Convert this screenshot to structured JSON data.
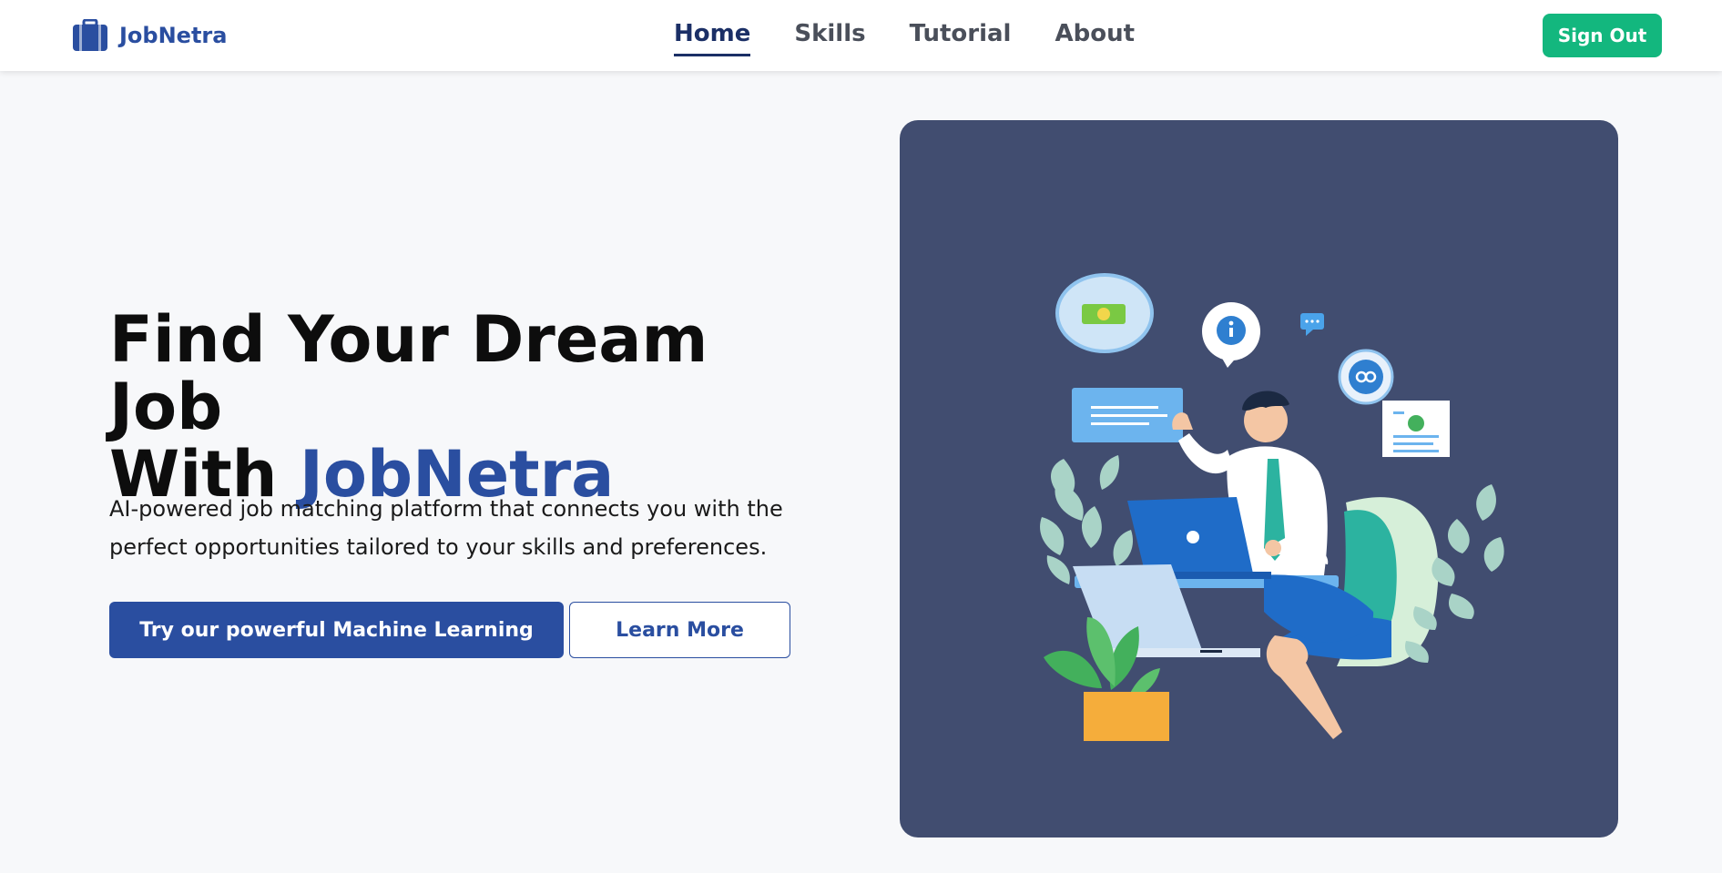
{
  "brand": {
    "name": "JobNetra",
    "icon": "briefcase-icon"
  },
  "nav": {
    "items": [
      {
        "label": "Home",
        "active": true
      },
      {
        "label": "Skills",
        "active": false
      },
      {
        "label": "Tutorial",
        "active": false
      },
      {
        "label": "About",
        "active": false
      }
    ]
  },
  "header": {
    "signout_label": "Sign Out"
  },
  "hero": {
    "title_line1": "Find Your Dream Job",
    "title_line2_prefix": "With ",
    "title_line2_accent": "JobNetra",
    "description": "AI-powered job matching platform that connects you with the perfect opportunities tailored to your skills and preferences.",
    "primary_button": "Try our powerful Machine Learning",
    "secondary_button": "Learn More"
  },
  "colors": {
    "brand": "#2a4ea0",
    "nav_active": "#1b2f66",
    "signout": "#13b77e",
    "illustration_bg": "#414d70"
  }
}
